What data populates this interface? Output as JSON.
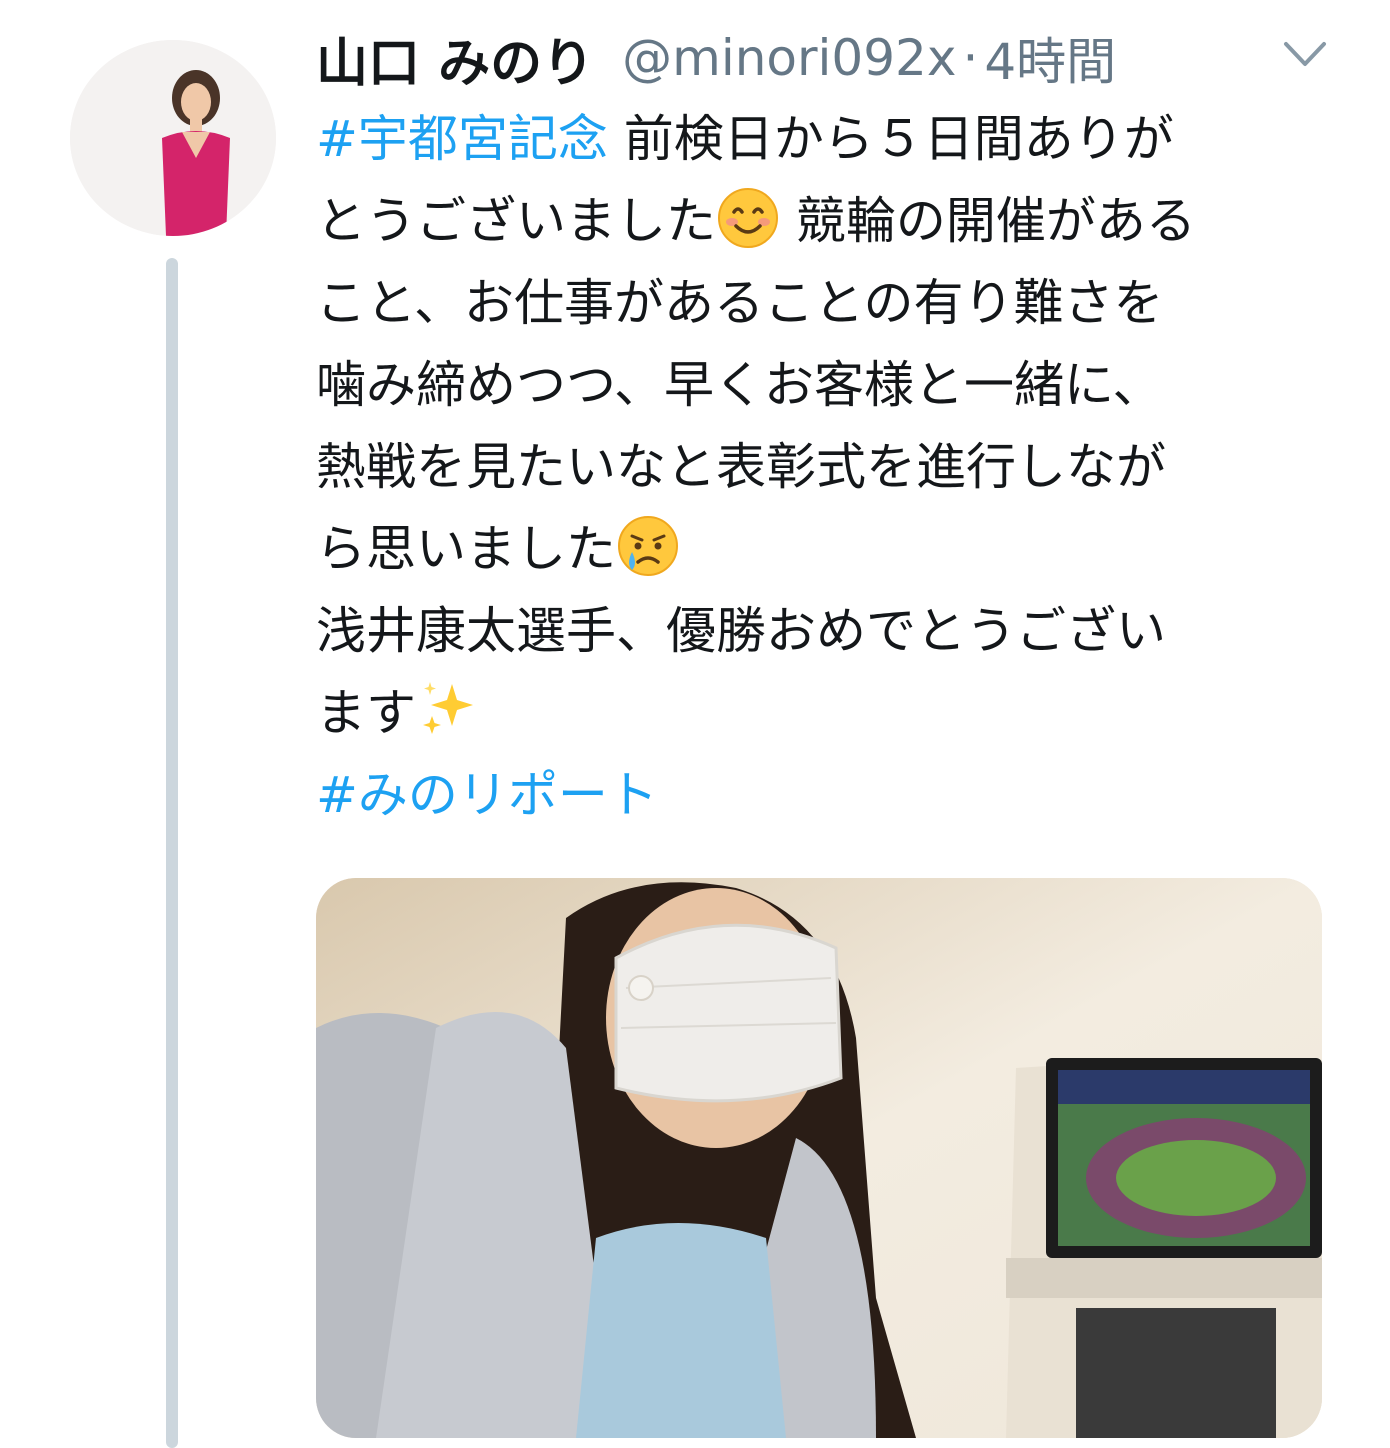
{
  "tweet": {
    "display_name": "山口 みのり",
    "handle": "@minori092x",
    "separator": "·",
    "timestamp": "4時間",
    "lines": [
      {
        "hashtag": "#宇都宮記念",
        "text": " 前検日から５日間ありが"
      },
      {
        "text_a": "とうございました",
        "text_b": " 競輪の開催がある"
      },
      {
        "text": "こと、お仕事があることの有り難さを"
      },
      {
        "text": "噛み締めつつ、早くお客様と一緒に、"
      },
      {
        "text": "熱戦を見たいなと表彰式を進行しなが"
      },
      {
        "text": "ら思いました"
      },
      {
        "text": " 浅井康太選手、優勝おめでとうござい"
      },
      {
        "text": "ます"
      },
      {
        "hashtag": "#みのリポート"
      }
    ],
    "emojis": [
      "smiling-face-emoji",
      "crying-face-emoji",
      "sparkles-emoji"
    ]
  },
  "colors": {
    "hashtag": "#1da1f2",
    "secondary_text": "#657786",
    "thread_line": "#ccd6dd"
  }
}
